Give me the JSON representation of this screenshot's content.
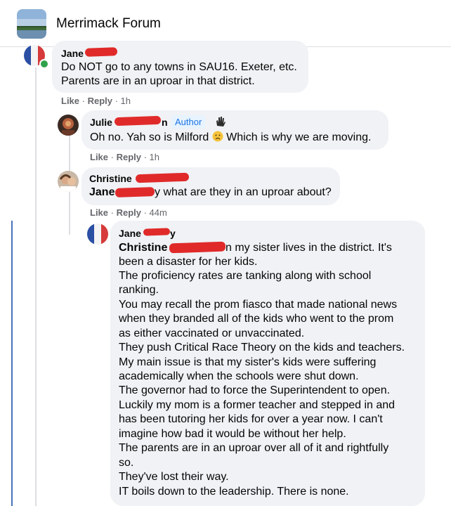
{
  "header": {
    "group_name": "Merrimack Forum"
  },
  "comments": [
    {
      "author": "Jane",
      "lines": [
        "Do NOT go to any towns in SAU16. Exeter, etc.",
        "Parents are in an uproar in that district."
      ],
      "actions": {
        "like": "Like",
        "reply": "Reply",
        "time": "1h"
      }
    },
    {
      "author": "Julie",
      "author_suffix": "n",
      "badge": "Author",
      "line_before_emoji": "Oh no. Yah so is Milford",
      "line_after_emoji": "Which is why we are moving.",
      "actions": {
        "like": "Like",
        "reply": "Reply",
        "time": "1h"
      }
    },
    {
      "author": "Christine",
      "mention": "Jane",
      "line_rest": "y what are they in an uproar about?",
      "actions": {
        "like": "Like",
        "reply": "Reply",
        "time": "44m"
      }
    },
    {
      "author": "Jane",
      "author_suffix": "y",
      "mention": "Christine",
      "first_line_rest": "n my sister lives in the district. It's",
      "lines": [
        "been a disaster for her kids.",
        "The proficiency rates are tanking along with school",
        "ranking.",
        "You may recall the prom fiasco that made national news",
        "when they branded all of the kids who went to the prom",
        "as either vaccinated or unvaccinated.",
        "They push Critical Race Theory on the kids and teachers.",
        "My main issue is that my sister's kids were suffering",
        "academically when the schools were shut down.",
        "The governor had to force the Superintendent to open.",
        "Luckily my mom is a former teacher and stepped in and",
        "has been tutoring her kids for over a year now. I can't",
        "imagine how bad it would be without her help.",
        "The parents are in an uproar over all of it and rightfully",
        "so.",
        "They've lost their way.",
        "IT boils down to the leadership. There is none."
      ]
    }
  ],
  "colors": {
    "bubble": "#f0f2f5",
    "meta_text": "#65676b",
    "redaction": "#e02a2a",
    "badge_text": "#1b74e4",
    "active_thread": "#4a74b8"
  }
}
